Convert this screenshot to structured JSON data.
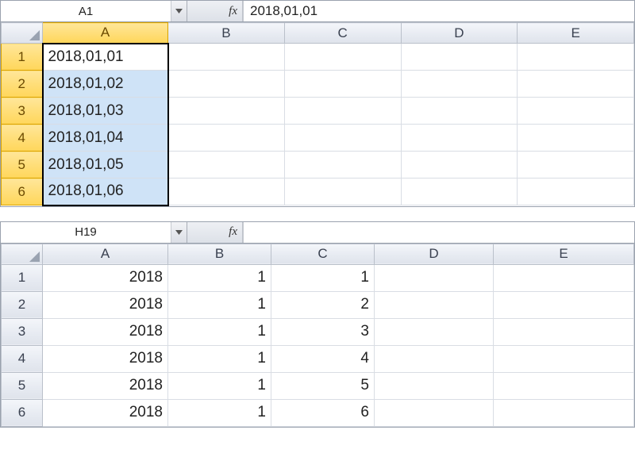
{
  "top": {
    "nameBox": "A1",
    "formulaValue": "2018,01,01",
    "columns": [
      "A",
      "B",
      "C",
      "D",
      "E"
    ],
    "rowNums": [
      "1",
      "2",
      "3",
      "4",
      "5",
      "6"
    ],
    "cells": {
      "A1": "2018,01,01",
      "A2": "2018,01,02",
      "A3": "2018,01,03",
      "A4": "2018,01,04",
      "A5": "2018,01,05",
      "A6": "2018,01,06"
    }
  },
  "bottom": {
    "nameBox": "H19",
    "formulaValue": "",
    "columns": [
      "A",
      "B",
      "C",
      "D",
      "E"
    ],
    "rowNums": [
      "1",
      "2",
      "3",
      "4",
      "5",
      "6"
    ],
    "cells": {
      "A1": "2018",
      "B1": "1",
      "C1": "1",
      "A2": "2018",
      "B2": "1",
      "C2": "2",
      "A3": "2018",
      "B3": "1",
      "C3": "3",
      "A4": "2018",
      "B4": "1",
      "C4": "4",
      "A5": "2018",
      "B5": "1",
      "C5": "5",
      "A6": "2018",
      "B6": "1",
      "C6": "6"
    }
  },
  "fxLabel": "fx"
}
